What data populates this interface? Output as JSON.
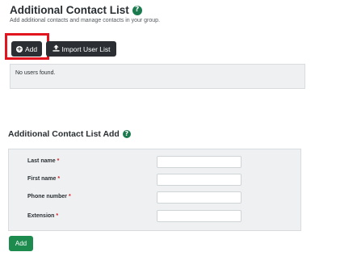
{
  "header": {
    "title": "Additional Contact List",
    "help_icon_glyph": "?",
    "subtitle": "Add additional contacts and manage contacts in your group."
  },
  "toolbar": {
    "add_label": "Add",
    "import_label": "Import User List"
  },
  "users_list": {
    "empty_message": "No users found."
  },
  "form": {
    "title": "Additional Contact List Add",
    "help_icon_glyph": "?",
    "fields": [
      {
        "label": "Last name",
        "required_mark": "*",
        "value": ""
      },
      {
        "label": "First name",
        "required_mark": "*",
        "value": ""
      },
      {
        "label": "Phone number",
        "required_mark": "*",
        "value": ""
      },
      {
        "label": "Extension",
        "required_mark": "*",
        "value": ""
      }
    ],
    "submit_label": "Add"
  },
  "colors": {
    "accent_green": "#1d8a4e",
    "dark_button": "#2b2f33",
    "highlight_red": "#e2141d",
    "panel_bg": "#eef0f1"
  }
}
